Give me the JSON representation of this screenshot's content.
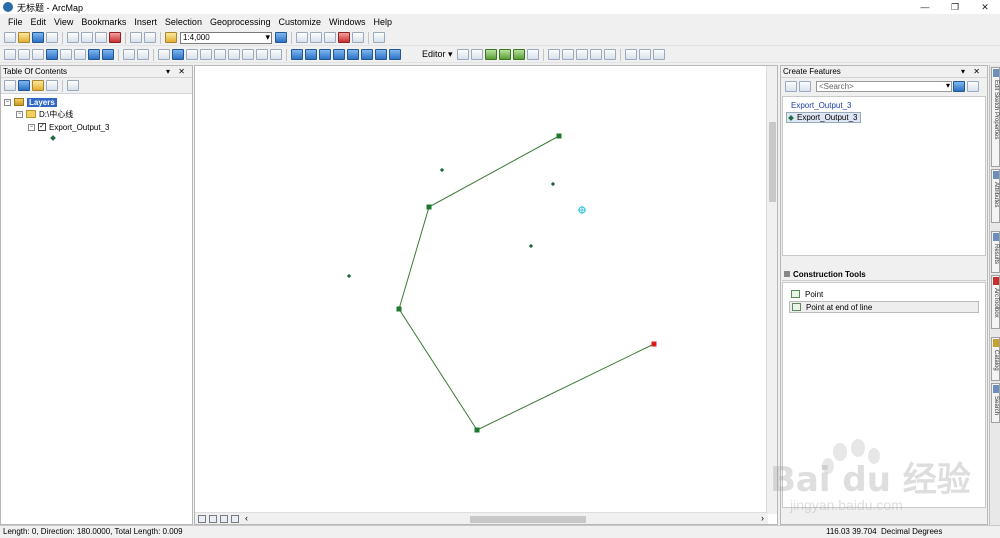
{
  "window": {
    "title": "无标题 - ArcMap",
    "min": "—",
    "restore": "❐",
    "close": "✕"
  },
  "menu": [
    "File",
    "Edit",
    "View",
    "Bookmarks",
    "Insert",
    "Selection",
    "Geoprocessing",
    "Customize",
    "Windows",
    "Help"
  ],
  "toolbar": {
    "scale": "1:4,000",
    "editor_label": "Editor ▾"
  },
  "toc": {
    "title": "Table Of Contents",
    "pin": "▾ ✕",
    "layers_label": "Layers",
    "folder": "D:\\中心线",
    "layer": "Export_Output_3"
  },
  "create_features": {
    "title": "Create Features",
    "pin": "▾ ✕",
    "search_placeholder": "<Search>",
    "group": "Export_Output_3",
    "item": "Export_Output_3"
  },
  "construction_tools": {
    "title": "Construction Tools",
    "items": [
      "Point",
      "Point at end of line"
    ]
  },
  "side_tabs": [
    "Edit Sketch Properties",
    "Attributes",
    "Results",
    "ArcToolbox",
    "Catalog",
    "Search"
  ],
  "status": {
    "left": "Length: 0, Direction: 180.0000, Total Length: 0.009",
    "coords": "116.03  39.704",
    "units": "Decimal Degrees"
  },
  "map": {
    "line_color": "#3a7a35",
    "vertex_color": "#1e7a2e",
    "end_vertex_color": "#e01818",
    "point_color": "#1d6b3c",
    "cursor_color": "#40c8e0"
  },
  "watermark": {
    "main": "Bai du 经验",
    "sub": "jingyan.baidu.com"
  }
}
